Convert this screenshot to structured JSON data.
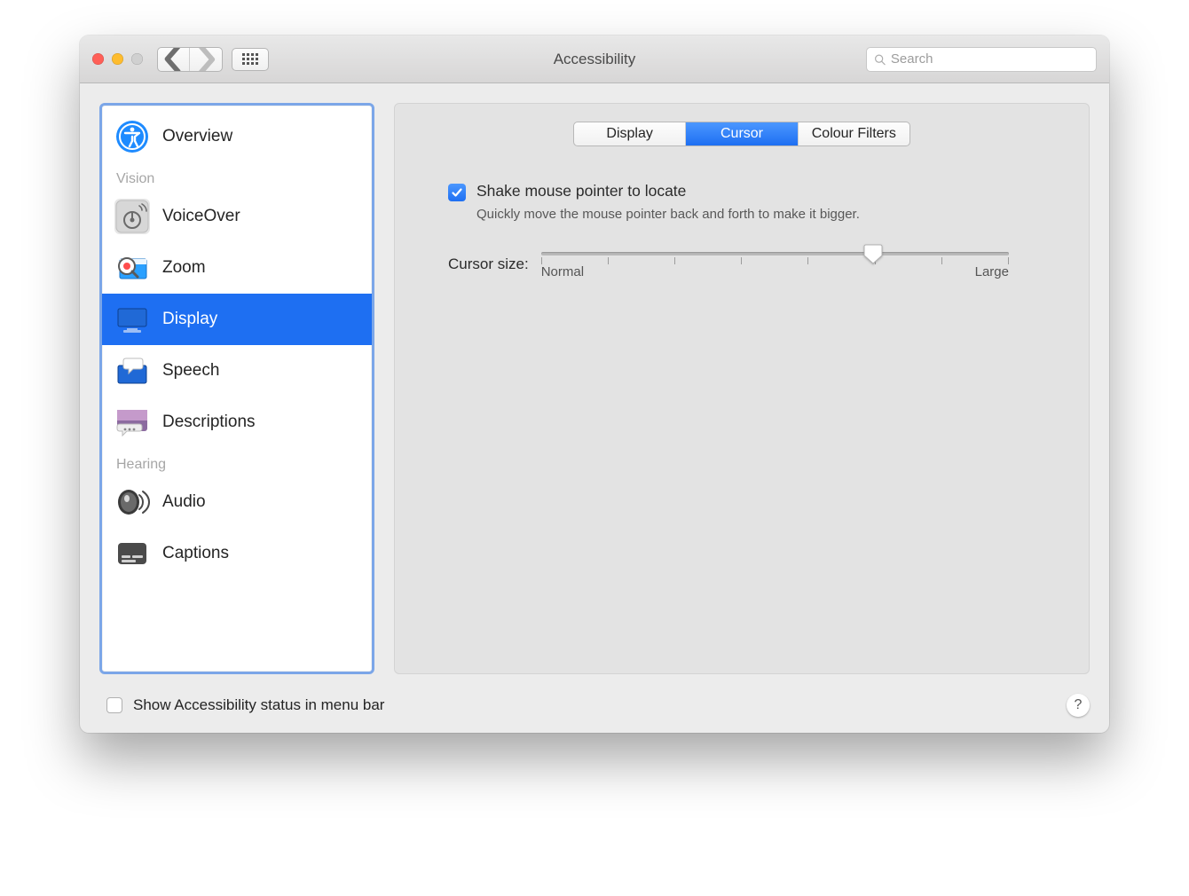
{
  "window": {
    "title": "Accessibility"
  },
  "search": {
    "placeholder": "Search"
  },
  "sidebar": {
    "items": [
      {
        "label": "Overview",
        "icon": "accessibility-icon",
        "selected": false
      },
      {
        "section": "Vision"
      },
      {
        "label": "VoiceOver",
        "icon": "voiceover-icon",
        "selected": false
      },
      {
        "label": "Zoom",
        "icon": "zoom-icon",
        "selected": false
      },
      {
        "label": "Display",
        "icon": "display-icon",
        "selected": true
      },
      {
        "label": "Speech",
        "icon": "speech-icon",
        "selected": false
      },
      {
        "label": "Descriptions",
        "icon": "descriptions-icon",
        "selected": false
      },
      {
        "section": "Hearing"
      },
      {
        "label": "Audio",
        "icon": "audio-icon",
        "selected": false
      },
      {
        "label": "Captions",
        "icon": "captions-icon",
        "selected": false
      }
    ]
  },
  "tabs": {
    "items": [
      "Display",
      "Cursor",
      "Colour Filters"
    ],
    "active": "Cursor"
  },
  "shake": {
    "checked": true,
    "title": "Shake mouse pointer to locate",
    "subtitle": "Quickly move the mouse pointer back and forth to make it bigger."
  },
  "slider": {
    "label": "Cursor size:",
    "min_label": "Normal",
    "max_label": "Large",
    "value_percent": 71
  },
  "footer": {
    "checked": false,
    "label": "Show Accessibility status in menu bar"
  },
  "help": "?"
}
